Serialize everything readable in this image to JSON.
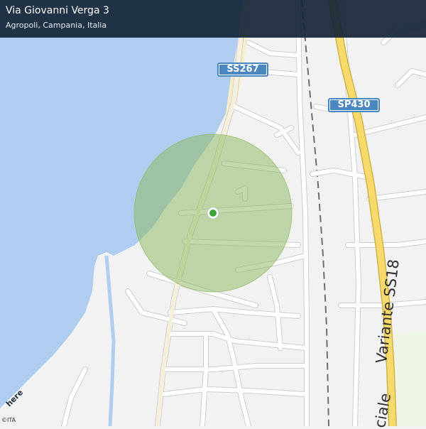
{
  "header": {
    "title": "Via Giovanni Verga 3",
    "subtitle": "Agropoli, Campania, Italia"
  },
  "map": {
    "road_shields": [
      "SS267",
      "SP430"
    ],
    "road_labels": [
      "Variante SS18",
      "ciale"
    ],
    "brand_logo": "here",
    "copyright": "©ITA"
  },
  "colors": {
    "sea": "#afcdef",
    "land": "#f3f2f3",
    "road_minor": "#ffffff",
    "road_major": "#f7da6b",
    "accuracy_circle": "#8fbb66",
    "location_dot": "#3aa53a",
    "header_bg": "#162638",
    "shield": "#4a86bf"
  },
  "icons": {
    "location": "location-dot-icon",
    "accuracy": "accuracy-circle"
  }
}
